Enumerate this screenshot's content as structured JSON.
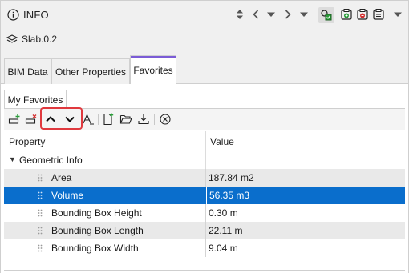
{
  "header": {
    "title": "INFO",
    "icons": [
      "info-icon",
      "sort-icon",
      "back-icon",
      "dropdown-icon",
      "forward-icon",
      "menu-dropdown-icon",
      "highlight-elements-icon",
      "add-icon",
      "remove-icon",
      "clipboard-icon"
    ]
  },
  "element": {
    "icon": "layers-icon",
    "name": "Slab.0.2"
  },
  "tabs": [
    {
      "label": "BIM Data",
      "active": false
    },
    {
      "label": "Other Properties",
      "active": false
    },
    {
      "label": "Favorites",
      "active": true
    }
  ],
  "subtab": {
    "label": "My Favorites"
  },
  "toolbar": {
    "icons": [
      "add-property-icon",
      "remove-property-icon",
      "move-up-icon",
      "move-down-icon",
      "rename-icon",
      "new-file-icon",
      "open-folder-icon",
      "download-icon",
      "clear-icon"
    ]
  },
  "table": {
    "headers": {
      "property": "Property",
      "value": "Value"
    },
    "group": {
      "label": "Geometric Info",
      "expanded": true
    },
    "rows": [
      {
        "property": "Area",
        "value": "187.84 m2",
        "selected": false
      },
      {
        "property": "Volume",
        "value": "56.35 m3",
        "selected": true
      },
      {
        "property": "Bounding Box Height",
        "value": "0.30 m",
        "selected": false
      },
      {
        "property": "Bounding Box Length",
        "value": "22.11 m",
        "selected": false
      },
      {
        "property": "Bounding Box Width",
        "value": "9.04 m",
        "selected": false
      }
    ]
  },
  "colors": {
    "accent": "#7b5cd6",
    "selection": "#0a6ecc",
    "highlight": "#e0393e",
    "toggle_green": "#2a9d3a"
  }
}
